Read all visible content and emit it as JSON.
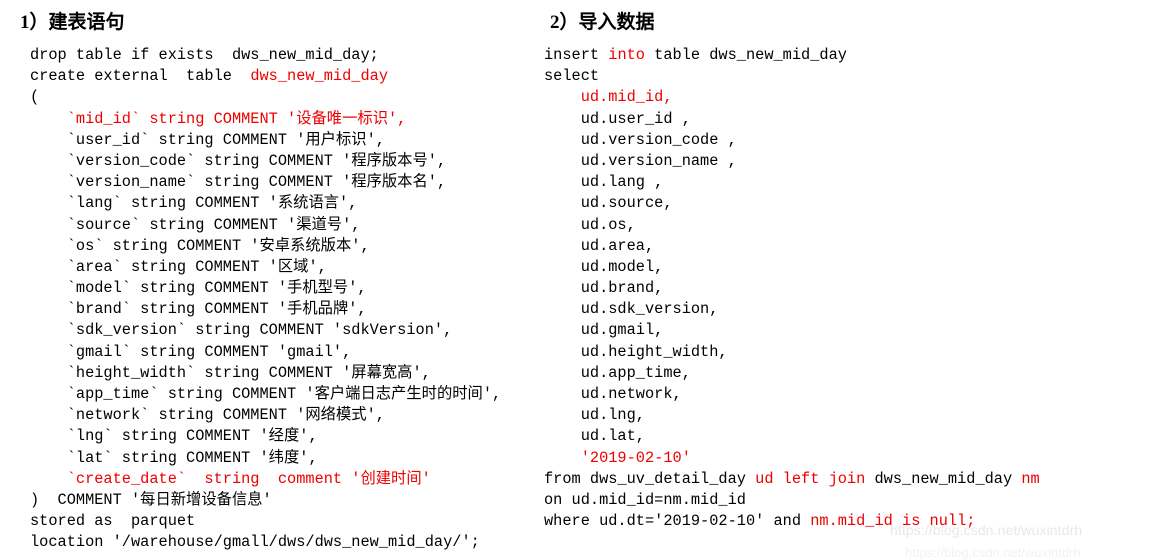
{
  "colors": {
    "background": "#ffffff",
    "text": "#000000",
    "keyword_highlight": "#ee0000",
    "watermark": "#e8e8e8"
  },
  "left": {
    "heading": "1）建表语句",
    "lines": [
      [
        {
          "t": "drop table if exists  dws_new_mid_day;",
          "c": "blk"
        }
      ],
      [
        {
          "t": "create external  table  ",
          "c": "blk"
        },
        {
          "t": "dws_new_mid_day",
          "c": "red"
        }
      ],
      [
        {
          "t": "(",
          "c": "blk"
        }
      ],
      [
        {
          "t": "    `mid_id` string COMMENT '设备唯一标识',",
          "c": "red"
        }
      ],
      [
        {
          "t": "    `user_id` string COMMENT '用户标识',",
          "c": "blk"
        }
      ],
      [
        {
          "t": "    `version_code` string COMMENT '程序版本号',",
          "c": "blk"
        }
      ],
      [
        {
          "t": "    `version_name` string COMMENT '程序版本名',",
          "c": "blk"
        }
      ],
      [
        {
          "t": "    `lang` string COMMENT '系统语言',",
          "c": "blk"
        }
      ],
      [
        {
          "t": "    `source` string COMMENT '渠道号',",
          "c": "blk"
        }
      ],
      [
        {
          "t": "    `os` string COMMENT '安卓系统版本',",
          "c": "blk"
        }
      ],
      [
        {
          "t": "    `area` string COMMENT '区域',",
          "c": "blk"
        }
      ],
      [
        {
          "t": "    `model` string COMMENT '手机型号',",
          "c": "blk"
        }
      ],
      [
        {
          "t": "    `brand` string COMMENT '手机品牌',",
          "c": "blk"
        }
      ],
      [
        {
          "t": "    `sdk_version` string COMMENT 'sdkVersion',",
          "c": "blk"
        }
      ],
      [
        {
          "t": "    `gmail` string COMMENT 'gmail',",
          "c": "blk"
        }
      ],
      [
        {
          "t": "    `height_width` string COMMENT '屏幕宽高',",
          "c": "blk"
        }
      ],
      [
        {
          "t": "    `app_time` string COMMENT '客户端日志产生时的时间',",
          "c": "blk"
        }
      ],
      [
        {
          "t": "    `network` string COMMENT '网络模式',",
          "c": "blk"
        }
      ],
      [
        {
          "t": "    `lng` string COMMENT '经度',",
          "c": "blk"
        }
      ],
      [
        {
          "t": "    `lat` string COMMENT '纬度',",
          "c": "blk"
        }
      ],
      [
        {
          "t": "    `create_date`  string  comment '创建时间'",
          "c": "red"
        }
      ],
      [
        {
          "t": ")  COMMENT '每日新增设备信息'",
          "c": "blk"
        }
      ],
      [
        {
          "t": "stored as  parquet",
          "c": "blk"
        }
      ],
      [
        {
          "t": "location '/warehouse/gmall/dws/dws_new_mid_day/';",
          "c": "blk"
        }
      ]
    ]
  },
  "right": {
    "heading": "2）导入数据",
    "lines": [
      [
        {
          "t": "insert ",
          "c": "blk"
        },
        {
          "t": "into",
          "c": "red"
        },
        {
          "t": " table dws_new_mid_day",
          "c": "blk"
        }
      ],
      [
        {
          "t": "select",
          "c": "blk"
        }
      ],
      [
        {
          "t": "    ud.mid_id,",
          "c": "red"
        }
      ],
      [
        {
          "t": "    ud.user_id ,",
          "c": "blk"
        }
      ],
      [
        {
          "t": "    ud.version_code ,",
          "c": "blk"
        }
      ],
      [
        {
          "t": "    ud.version_name ,",
          "c": "blk"
        }
      ],
      [
        {
          "t": "    ud.lang ,",
          "c": "blk"
        }
      ],
      [
        {
          "t": "    ud.source,",
          "c": "blk"
        }
      ],
      [
        {
          "t": "    ud.os,",
          "c": "blk"
        }
      ],
      [
        {
          "t": "    ud.area,",
          "c": "blk"
        }
      ],
      [
        {
          "t": "    ud.model,",
          "c": "blk"
        }
      ],
      [
        {
          "t": "    ud.brand,",
          "c": "blk"
        }
      ],
      [
        {
          "t": "    ud.sdk_version,",
          "c": "blk"
        }
      ],
      [
        {
          "t": "    ud.gmail,",
          "c": "blk"
        }
      ],
      [
        {
          "t": "    ud.height_width,",
          "c": "blk"
        }
      ],
      [
        {
          "t": "    ud.app_time,",
          "c": "blk"
        }
      ],
      [
        {
          "t": "    ud.network,",
          "c": "blk"
        }
      ],
      [
        {
          "t": "    ud.lng,",
          "c": "blk"
        }
      ],
      [
        {
          "t": "    ud.lat,",
          "c": "blk"
        }
      ],
      [
        {
          "t": "    '2019-02-10'",
          "c": "red"
        }
      ],
      [
        {
          "t": "from dws_uv_detail_day ",
          "c": "blk"
        },
        {
          "t": "ud left join",
          "c": "red"
        },
        {
          "t": " dws_new_mid_day ",
          "c": "blk"
        },
        {
          "t": "nm",
          "c": "red"
        }
      ],
      [
        {
          "t": "on ud.mid_id=nm.mid_id",
          "c": "blk"
        }
      ],
      [
        {
          "t": "where ud.dt='2019-02-10' and ",
          "c": "blk"
        },
        {
          "t": "nm.mid_id is null;",
          "c": "red"
        }
      ]
    ]
  },
  "watermark": {
    "url": "https://blog.csdn.net/wuxintdrh"
  }
}
